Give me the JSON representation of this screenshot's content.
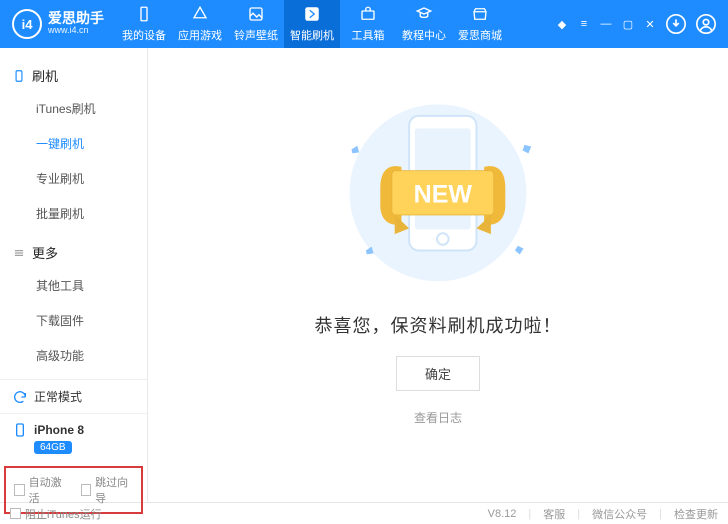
{
  "app": {
    "brand": "爱思助手",
    "url": "www.i4.cn"
  },
  "topTabs": [
    {
      "label": "我的设备"
    },
    {
      "label": "应用游戏"
    },
    {
      "label": "铃声壁纸"
    },
    {
      "label": "智能刷机"
    },
    {
      "label": "工具箱"
    },
    {
      "label": "教程中心"
    },
    {
      "label": "爱思商城"
    }
  ],
  "sidebar": {
    "groupFlash": "刷机",
    "flashItems": [
      "iTunes刷机",
      "一键刷机",
      "专业刷机",
      "批量刷机"
    ],
    "groupMore": "更多",
    "moreItems": [
      "其他工具",
      "下载固件",
      "高级功能"
    ]
  },
  "status": {
    "mode": "正常模式",
    "device": "iPhone 8",
    "capacity": "64GB"
  },
  "bottomChecks": {
    "autoActivate": "自动激活",
    "skipWizard": "跳过向导"
  },
  "content": {
    "banner": "NEW",
    "successMsg": "恭喜您，保资料刷机成功啦！",
    "confirm": "确定",
    "viewLog": "查看日志"
  },
  "statusbar": {
    "blockItunes": "阻止iTunes运行",
    "version": "V8.12",
    "service": "客服",
    "wechat": "微信公众号",
    "checkUpdate": "检查更新"
  }
}
